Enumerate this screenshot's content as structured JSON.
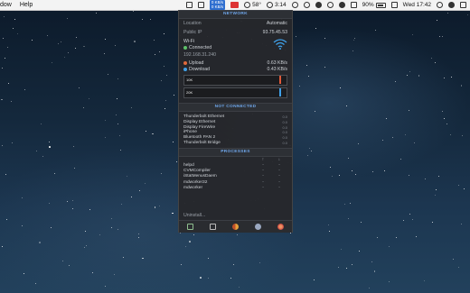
{
  "menubar": {
    "menus": [
      "dow",
      "Help"
    ],
    "temperature": "58°",
    "time_small": "3:14",
    "battery_percent": "90%",
    "clock": "Wed 17:42",
    "net_badge_top": "0 KB/s",
    "net_badge_bottom": "0 KB/s"
  },
  "panel": {
    "network_header": "NETWORK",
    "location_label": "Location",
    "location_value": "Automatic",
    "public_ip_label": "Public IP",
    "public_ip_value": "93.75.45.53",
    "wifi_label": "Wi-Fi",
    "wifi_status": "Connected",
    "local_ip": "192.168.31.240",
    "upload_label": "Upload",
    "upload_value": "0.63 KB/s",
    "download_label": "Download",
    "download_value": "0.43 KB/s",
    "graph_top_label": "10K",
    "graph_bottom_label": "20K",
    "not_connected_header": "NOT CONNECTED",
    "services": [
      {
        "name": "Thunderbolt Ethernet",
        "value": "0.0"
      },
      {
        "name": "Display Ethernet",
        "value": "0.0"
      },
      {
        "name": "Display FireWire",
        "value": "0.0"
      },
      {
        "name": "iPhone",
        "value": "0.0"
      },
      {
        "name": "Bluetooth PAN 2",
        "value": "0.0"
      },
      {
        "name": "Thunderbolt Bridge",
        "value": "0.0"
      }
    ],
    "processes_header": "PROCESSES",
    "process_col_up": "↑",
    "process_col_down": "↓",
    "processes": [
      {
        "name": "helpd",
        "up": "-",
        "down": "-"
      },
      {
        "name": "CVMCompiler",
        "up": "-",
        "down": "-"
      },
      {
        "name": "iStatMenusDaem",
        "up": "-",
        "down": "-"
      },
      {
        "name": "mdworker32",
        "up": "-",
        "down": "-"
      },
      {
        "name": "mdworker",
        "up": "-",
        "down": "-"
      }
    ],
    "footer_text": "Uninstall..."
  },
  "colors": {
    "accent": "#6fa6ea",
    "wifi_connected": "#5ec26a",
    "upload": "#e06a3c",
    "download": "#3fa0e8"
  },
  "icons": {
    "wifi": "wifi-icon",
    "dock": [
      "monitor-icon",
      "display-icon",
      "cpu-icon",
      "disk-icon",
      "network-icon"
    ]
  }
}
